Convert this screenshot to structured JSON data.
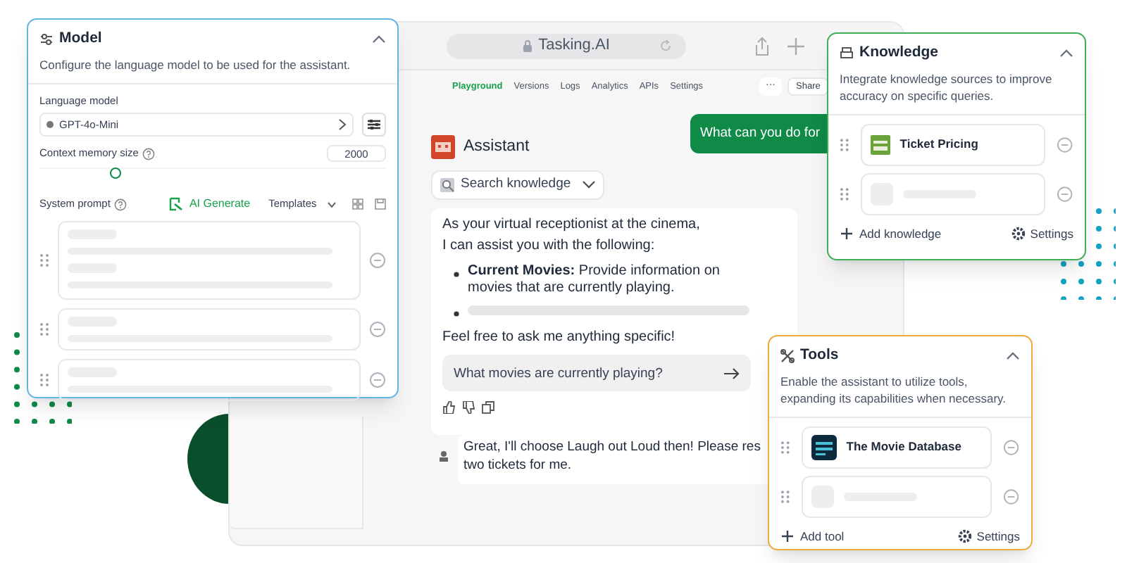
{
  "browser": {
    "address": "Tasking.AI",
    "nav_tabs": [
      {
        "label": "Playground",
        "selected": true
      },
      {
        "label": "Versions",
        "selected": false
      },
      {
        "label": "Logs",
        "selected": false
      },
      {
        "label": "Analytics",
        "selected": false
      },
      {
        "label": "APIs",
        "selected": false
      },
      {
        "label": "Settings",
        "selected": false
      }
    ],
    "more": "···",
    "share": "Share"
  },
  "assistant": {
    "name": "Assistant",
    "knowledge_dropdown": "Search knowledge",
    "user_message": "What can you do for",
    "reply_intro": [
      "As your virtual receptionist at the cinema,",
      "I can assist you with the following:"
    ],
    "reply_bullets": [
      {
        "kind": "text",
        "text": "**Current Movies:** Provide information on movies that are currently playing."
      },
      {
        "kind": "placeholder"
      }
    ],
    "reply_closing": "Feel free to ask me anything specific!",
    "suggestion": "What movies are currently playing?",
    "next_message": [
      "Great, I'll choose Laugh out Loud then! Please res",
      "two tickets for me."
    ]
  },
  "model_panel": {
    "title": "Model",
    "description": "Configure the language model to be used for the assistant.",
    "language_model_label": "Language model",
    "language_model": "GPT-4o-Mini",
    "context_label": "Context memory size",
    "context_value": "2000",
    "context_slider": {
      "level": 0.22
    },
    "system_prompt_label": "System prompt",
    "ai_generate": "AI Generate",
    "templates": "Templates"
  },
  "knowledge_panel": {
    "title": "Knowledge",
    "description": "Integrate knowledge sources to improve accuracy on specific queries.",
    "items": [
      {
        "kind": "item",
        "label": "Ticket Pricing"
      },
      {
        "kind": "placeholder"
      }
    ],
    "add": "Add knowledge",
    "settings": "Settings"
  },
  "tools_panel": {
    "title": "Tools",
    "description": "Enable the assistant to utilize tools, expanding its capabilities when necessary.",
    "items": [
      {
        "kind": "item",
        "label": "The Movie Database"
      },
      {
        "kind": "placeholder"
      }
    ],
    "add": "Add tool",
    "settings": "Settings"
  }
}
